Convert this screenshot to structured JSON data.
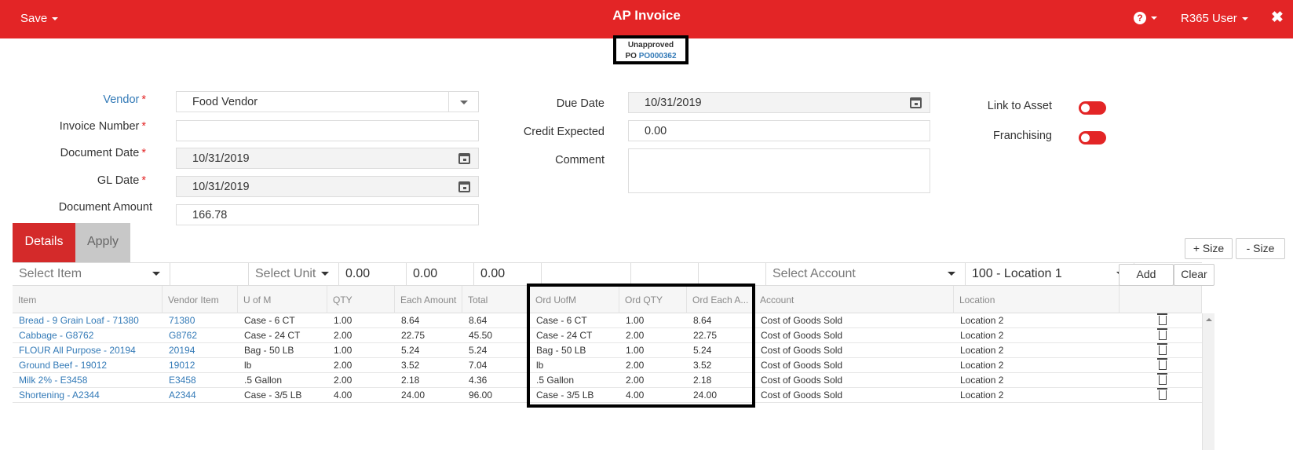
{
  "header": {
    "save_label": "Save",
    "title": "AP Invoice",
    "help_icon": "?",
    "user_label": "R365 User",
    "close_icon": "✖"
  },
  "status": {
    "state": "Unapproved",
    "po_label": "PO",
    "po_number": "PO000362"
  },
  "form": {
    "vendor_label": "Vendor",
    "vendor_value": "Food Vendor",
    "invoice_number_label": "Invoice Number",
    "invoice_number_value": "",
    "document_date_label": "Document Date",
    "document_date_value": "10/31/2019",
    "gl_date_label": "GL Date",
    "gl_date_value": "10/31/2019",
    "document_amount_label": "Document Amount",
    "document_amount_value": "166.78",
    "due_date_label": "Due Date",
    "due_date_value": "10/31/2019",
    "credit_expected_label": "Credit Expected",
    "credit_expected_value": "0.00",
    "comment_label": "Comment",
    "comment_value": "",
    "link_to_asset_label": "Link to Asset",
    "link_to_asset_on": false,
    "franchising_label": "Franchising",
    "franchising_on": false,
    "required_marker": "*"
  },
  "tabs": {
    "details": "Details",
    "apply": "Apply"
  },
  "size_buttons": {
    "plus": "+ Size",
    "minus": "- Size"
  },
  "entry": {
    "item_placeholder": "Select Item",
    "vendor_item": "",
    "unit_placeholder": "Select Unit",
    "qty": "0.00",
    "each_amount": "0.00",
    "total": "0.00",
    "ord_uofm": "",
    "ord_qty": "",
    "ord_each": "",
    "account_placeholder": "Select Account",
    "location": "100 - Location 1",
    "add_label": "Add",
    "clear_label": "Clear"
  },
  "grid": {
    "columns": [
      "Item",
      "Vendor Item",
      "U of M",
      "QTY",
      "Each Amount",
      "Total",
      "Ord UofM",
      "Ord QTY",
      "Ord Each A...",
      "Account",
      "Location",
      ""
    ],
    "rows": [
      [
        "Bread - 9 Grain Loaf - 71380",
        "71380",
        "Case - 6 CT",
        "1.00",
        "8.64",
        "8.64",
        "Case - 6 CT",
        "1.00",
        "8.64",
        "Cost of Goods Sold",
        "Location 2"
      ],
      [
        "Cabbage - G8762",
        "G8762",
        "Case - 24 CT",
        "2.00",
        "22.75",
        "45.50",
        "Case - 24 CT",
        "2.00",
        "22.75",
        "Cost of Goods Sold",
        "Location 2"
      ],
      [
        "FLOUR All Purpose - 20194",
        "20194",
        "Bag - 50 LB",
        "1.00",
        "5.24",
        "5.24",
        "Bag - 50 LB",
        "1.00",
        "5.24",
        "Cost of Goods Sold",
        "Location 2"
      ],
      [
        "Ground Beef - 19012",
        "19012",
        "lb",
        "2.00",
        "3.52",
        "7.04",
        "lb",
        "2.00",
        "3.52",
        "Cost of Goods Sold",
        "Location 2"
      ],
      [
        "Milk 2% - E3458",
        "E3458",
        ".5 Gallon",
        "2.00",
        "2.18",
        "4.36",
        ".5 Gallon",
        "2.00",
        "2.18",
        "Cost of Goods Sold",
        "Location 2"
      ],
      [
        "Shortening - A2344",
        "A2344",
        "Case - 3/5 LB",
        "4.00",
        "24.00",
        "96.00",
        "Case - 3/5 LB",
        "4.00",
        "24.00",
        "Cost of Goods Sold",
        "Location 2"
      ]
    ]
  },
  "colors": {
    "brand": "#e32526",
    "link": "#337ab7"
  }
}
